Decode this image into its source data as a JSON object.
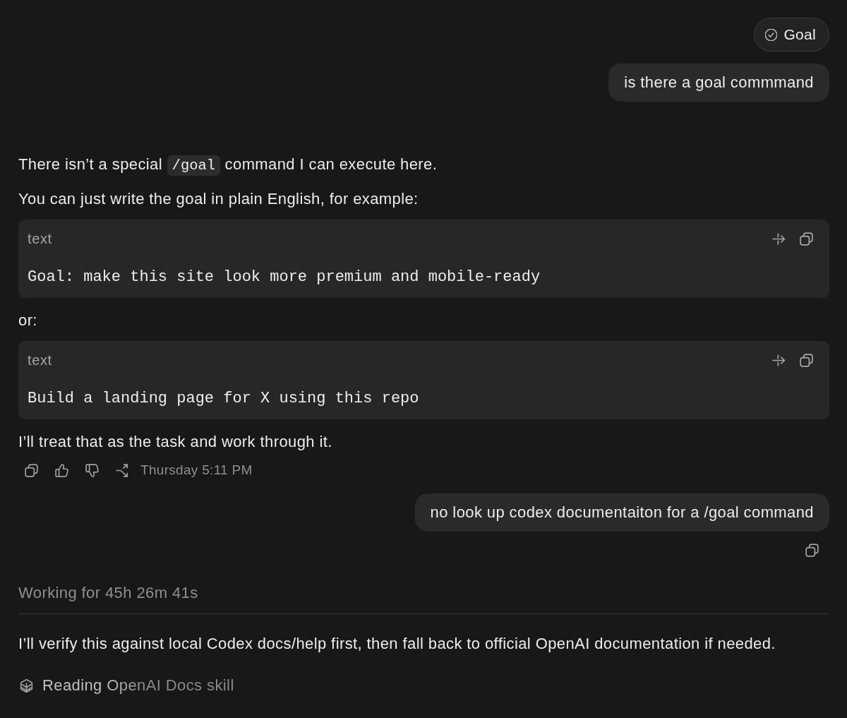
{
  "messages": [
    {
      "kind": "user",
      "chip": {
        "label": "Goal"
      },
      "text": "is there a goal commmand",
      "copy_action": false
    },
    {
      "kind": "assistant",
      "blocks": [
        {
          "kind": "paragraph",
          "parts": [
            {
              "kind": "text",
              "text": "There isn’t a special"
            },
            {
              "kind": "code",
              "text": "/goal"
            },
            {
              "kind": "text",
              "text": "command I can execute here."
            }
          ]
        },
        {
          "kind": "paragraph",
          "text": "You can just write the goal in plain English, for example:"
        },
        {
          "kind": "code_block",
          "language": "text",
          "code": "Goal: make this site look more premium and mobile-ready"
        },
        {
          "kind": "paragraph",
          "text": "or:"
        },
        {
          "kind": "code_block",
          "language": "text",
          "code": "Build a landing page for X using this repo"
        },
        {
          "kind": "paragraph",
          "text": "I’ll treat that as the task and work through it."
        }
      ],
      "timestamp": "Thursday 5:11 PM"
    },
    {
      "kind": "user",
      "text": "no look up codex documentaiton for a /goal command",
      "copy_action": true
    },
    {
      "kind": "assistant",
      "working": "Working for 45h 26m 41s",
      "blocks": [
        {
          "kind": "paragraph",
          "text": "I’ll verify this against local Codex docs/help first, then fall back to official OpenAI documentation if needed."
        }
      ],
      "activity": "Reading OpenAI Docs skill"
    }
  ]
}
